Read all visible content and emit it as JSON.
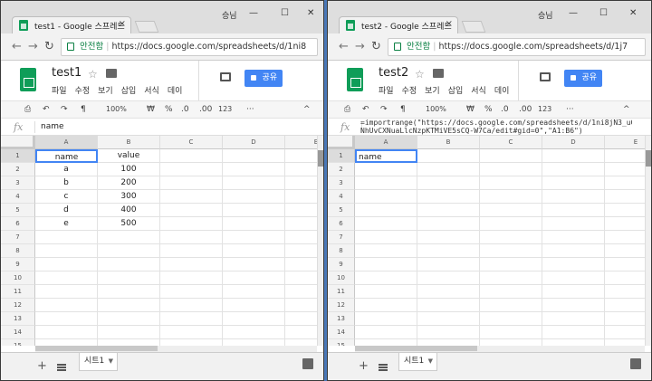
{
  "left": {
    "tab_title": "test1 - Google 스프레드",
    "user": "승님",
    "secure": "안전함",
    "url": "https://docs.google.com/spreadsheets/d/1ni8",
    "doc_title": "test1",
    "menu": [
      "파일",
      "수정",
      "보기",
      "삽입",
      "서식",
      "데이"
    ],
    "share": "공유",
    "zoom": "100%",
    "formula_value": "name",
    "col_headers": [
      "A",
      "B",
      "C",
      "D",
      "E"
    ],
    "row_numbers": [
      "1",
      "2",
      "3",
      "4",
      "5",
      "6",
      "7",
      "8",
      "9",
      "10",
      "11",
      "12",
      "13",
      "14",
      "15"
    ],
    "rows": [
      [
        "name",
        "value"
      ],
      [
        "a",
        "100"
      ],
      [
        "b",
        "200"
      ],
      [
        "c",
        "300"
      ],
      [
        "d",
        "400"
      ],
      [
        "e",
        "500"
      ]
    ],
    "sheet_tab": "시트1"
  },
  "right": {
    "tab_title": "test2 - Google 스프레드",
    "user": "승님",
    "secure": "안전함",
    "url": "https://docs.google.com/spreadsheets/d/1j7",
    "doc_title": "test2",
    "menu": [
      "파일",
      "수정",
      "보기",
      "삽입",
      "서식",
      "데이"
    ],
    "share": "공유",
    "zoom": "100%",
    "formula_line1": "=importrange(\"https://docs.google.com/spreadsheets/d/1ni8jN3_uG",
    "formula_line2": "NhUvCXNuaLlcNzpKTMiVE5sCQ-W7Ca/edit#gid=0\",\"A1:B6\")",
    "col_headers": [
      "A",
      "B",
      "C",
      "D",
      "E"
    ],
    "row_numbers": [
      "1",
      "2",
      "3",
      "4",
      "5",
      "6",
      "7",
      "8",
      "9",
      "10",
      "11",
      "12",
      "13",
      "14",
      "15"
    ],
    "a1": "name",
    "sheet_tab": "시트1"
  },
  "toolbar": {
    "currency": "₩",
    "percent": "%",
    "dec_dec": ".0",
    "dec_inc": ".00",
    "format_123": "123",
    "more": "···"
  },
  "fx": "fx",
  "icons": [
    "sheets-icon",
    "star-icon",
    "folder-icon",
    "comment-icon",
    "lock-icon",
    "back-icon",
    "forward-icon",
    "reload-icon",
    "print-icon",
    "undo-icon",
    "redo-icon",
    "paint-format-icon",
    "add-sheet-icon",
    "sheet-list-icon",
    "explore-icon"
  ]
}
